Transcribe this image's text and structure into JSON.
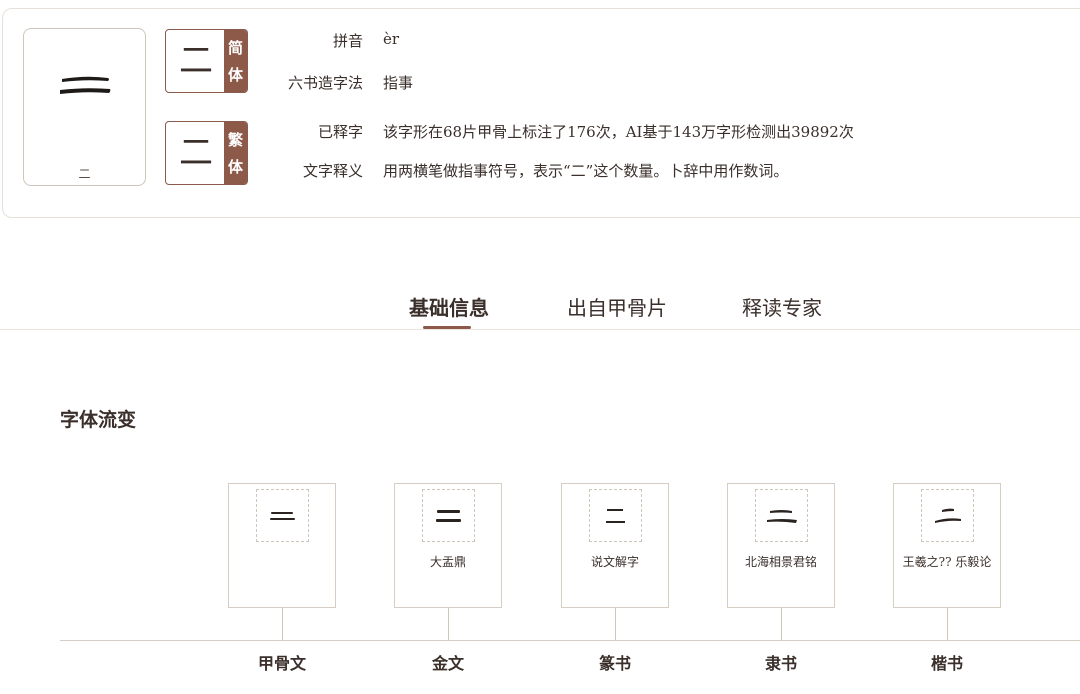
{
  "character": {
    "glyph": "二",
    "caption": "二",
    "simplified": {
      "glyph": "二",
      "tag": [
        "简",
        "体"
      ]
    },
    "traditional": {
      "glyph": "二",
      "tag": [
        "繁",
        "体"
      ]
    }
  },
  "fields": [
    {
      "label": "拼音",
      "value": "èr"
    },
    {
      "label": "六书造字法",
      "value": "指事"
    },
    {
      "label": "已释字",
      "value": "该字形在68片甲骨上标注了176次，AI基于143万字形检测出39892次"
    },
    {
      "label": "文字释义",
      "value": "用两横笔做指事符号，表示“二”这个数量。卜辞中用作数词。"
    }
  ],
  "tabs": [
    {
      "label": "基础信息",
      "active": true
    },
    {
      "label": "出自甲骨片",
      "active": false
    },
    {
      "label": "释读专家",
      "active": false
    }
  ],
  "section": {
    "title": "字体流变"
  },
  "evolution": [
    {
      "script": "甲骨文",
      "source": ""
    },
    {
      "script": "金文",
      "source": "大盂鼎"
    },
    {
      "script": "篆书",
      "source": "说文解字"
    },
    {
      "script": "隶书",
      "source": "北海相景君铭"
    },
    {
      "script": "楷书",
      "source": "王羲之?? 乐毅论"
    }
  ],
  "colors": {
    "accent": "#8d5a4a",
    "border": "#d6cec3",
    "text": "#3a2f2a"
  }
}
